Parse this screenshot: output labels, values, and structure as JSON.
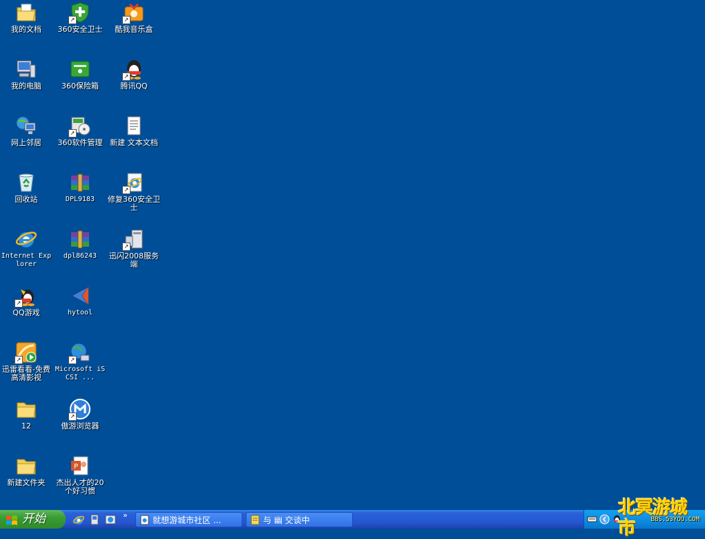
{
  "desktop": {
    "icons": [
      {
        "label": "我的文档",
        "icon": "folder-documents-icon"
      },
      {
        "label": "360安全卫士",
        "icon": "shield-icon"
      },
      {
        "label": "酷我音乐盒",
        "icon": "music-box-icon"
      },
      {
        "label": "我的电脑",
        "icon": "computer-icon"
      },
      {
        "label": "360保险箱",
        "icon": "safe-icon"
      },
      {
        "label": "腾讯QQ",
        "icon": "qq-penguin-icon"
      },
      {
        "label": "网上邻居",
        "icon": "network-icon"
      },
      {
        "label": "360软件管理",
        "icon": "software-manager-icon"
      },
      {
        "label": "新建 文本文档",
        "icon": "text-document-icon"
      },
      {
        "label": "回收站",
        "icon": "recycle-bin-icon"
      },
      {
        "label": "DPL9183",
        "icon": "winrar-icon"
      },
      {
        "label": "修复360安全卫士",
        "icon": "ie-document-icon"
      },
      {
        "label": "Internet Explorer",
        "icon": "internet-explorer-icon"
      },
      {
        "label": "dpl86243",
        "icon": "winrar-icon"
      },
      {
        "label": "迅闪2008服务端",
        "icon": "server-icon"
      },
      {
        "label": "QQ游戏",
        "icon": "qq-game-icon"
      },
      {
        "label": "hytool",
        "icon": "hytool-arrow-icon"
      },
      {
        "label": "迅雷看看-免费高清影视",
        "icon": "xunlei-player-icon"
      },
      {
        "label": "Microsoft iSCSI ...",
        "icon": "globe-network-icon"
      },
      {
        "label": "12",
        "icon": "folder-icon"
      },
      {
        "label": "傲游浏览器",
        "icon": "maxthon-icon"
      },
      {
        "label": "新建文件夹",
        "icon": "folder-icon"
      },
      {
        "label": "杰出人才的20个好习惯",
        "icon": "powerpoint-icon"
      }
    ]
  },
  "taskbar": {
    "start_label": "开始",
    "tasks": [
      {
        "label": "就想游城市社区 ..."
      },
      {
        "label": "与 幽 交谈中"
      }
    ],
    "quick_launch_more": "»"
  },
  "watermark": {
    "title": "北冥游城市",
    "url": "BBS.53YOU.COM"
  },
  "colors": {
    "desktop": "#004e98",
    "taskbar": "#2456cf",
    "start": "#3a9c34",
    "tray": "#0d8ae0"
  }
}
